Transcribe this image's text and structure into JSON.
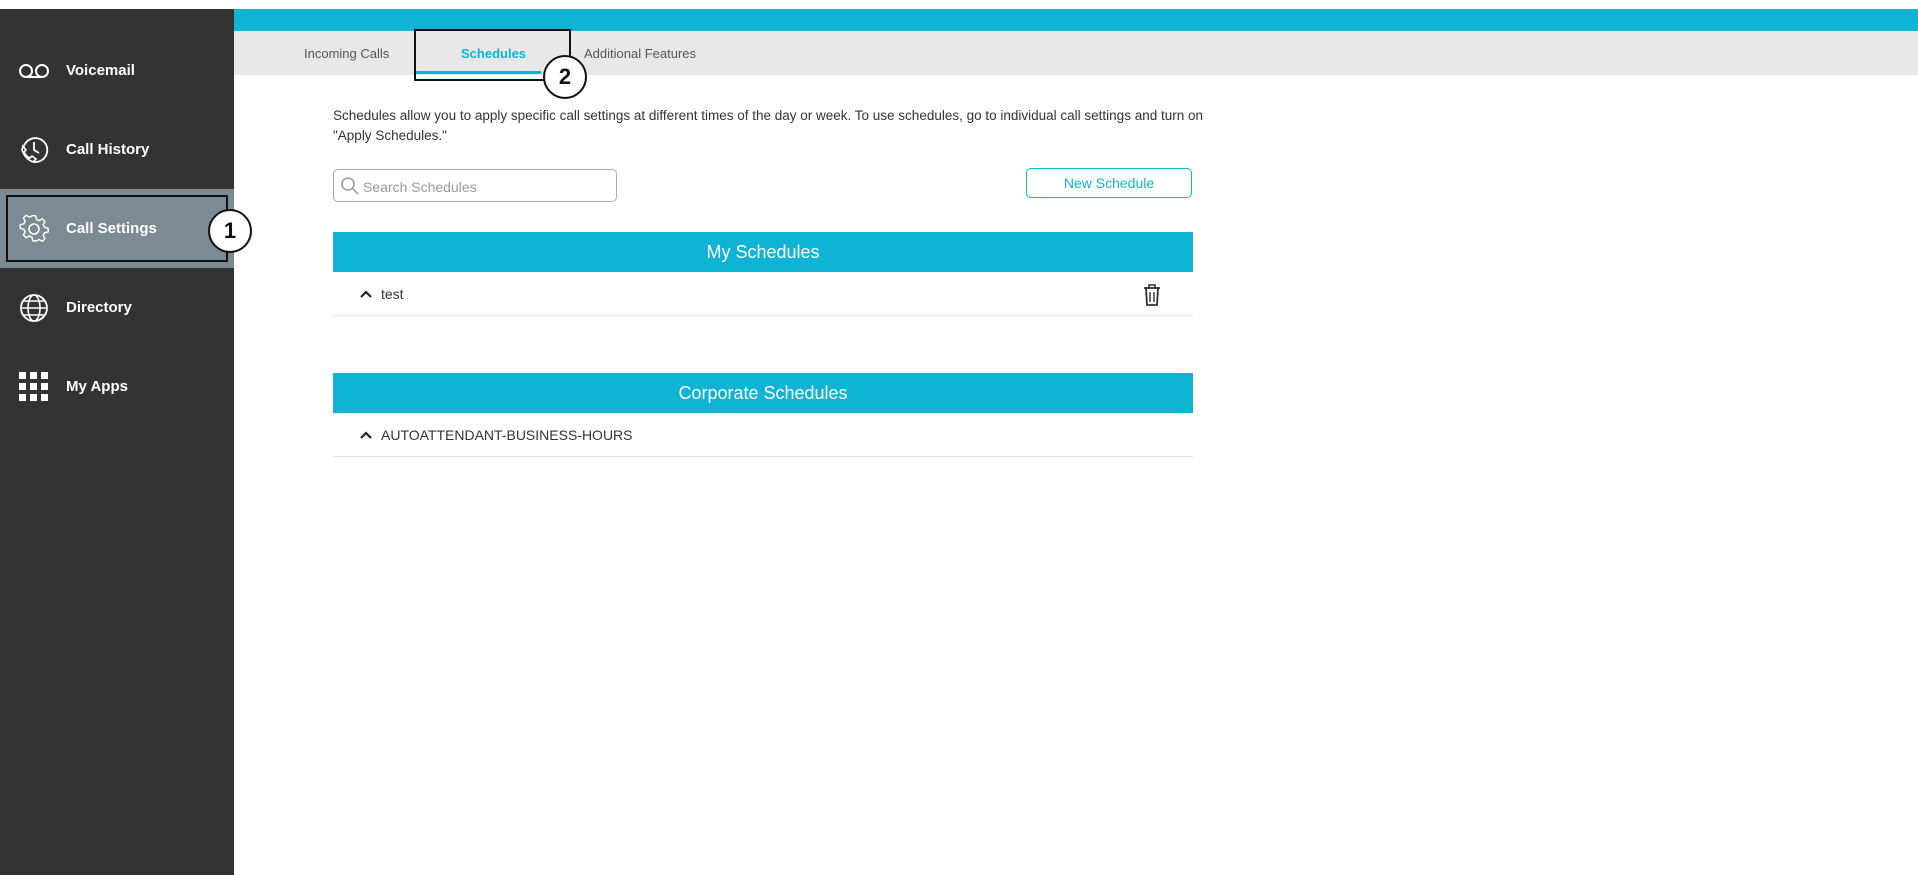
{
  "sidebar": {
    "items": [
      {
        "label": "Voicemail",
        "icon": "voicemail-icon"
      },
      {
        "label": "Call History",
        "icon": "call-history-icon"
      },
      {
        "label": "Call Settings",
        "icon": "gear-icon",
        "active": true
      },
      {
        "label": "Directory",
        "icon": "globe-icon"
      },
      {
        "label": "My Apps",
        "icon": "apps-grid-icon"
      }
    ]
  },
  "tabs": [
    {
      "label": "Incoming Calls"
    },
    {
      "label": "Schedules",
      "active": true
    },
    {
      "label": "Additional Features"
    }
  ],
  "callouts": {
    "one": "1",
    "two": "2"
  },
  "main": {
    "description": "Schedules allow you to apply specific call settings at different times of the day or week. To use schedules, go to individual call settings and turn on \"Apply Schedules.\"",
    "search_placeholder": "Search Schedules",
    "new_schedule_label": "New Schedule",
    "my_schedules": {
      "title": "My Schedules",
      "items": [
        {
          "name": "test"
        }
      ]
    },
    "corporate_schedules": {
      "title": "Corporate Schedules",
      "items": [
        {
          "name": "AUTOATTENDANT-BUSINESS-HOURS"
        }
      ]
    }
  },
  "colors": {
    "accent": "#0fb4d4",
    "sidebar": "#333333",
    "sidebar_active": "#7b8a93",
    "tabbar": "#e8e8e8"
  }
}
